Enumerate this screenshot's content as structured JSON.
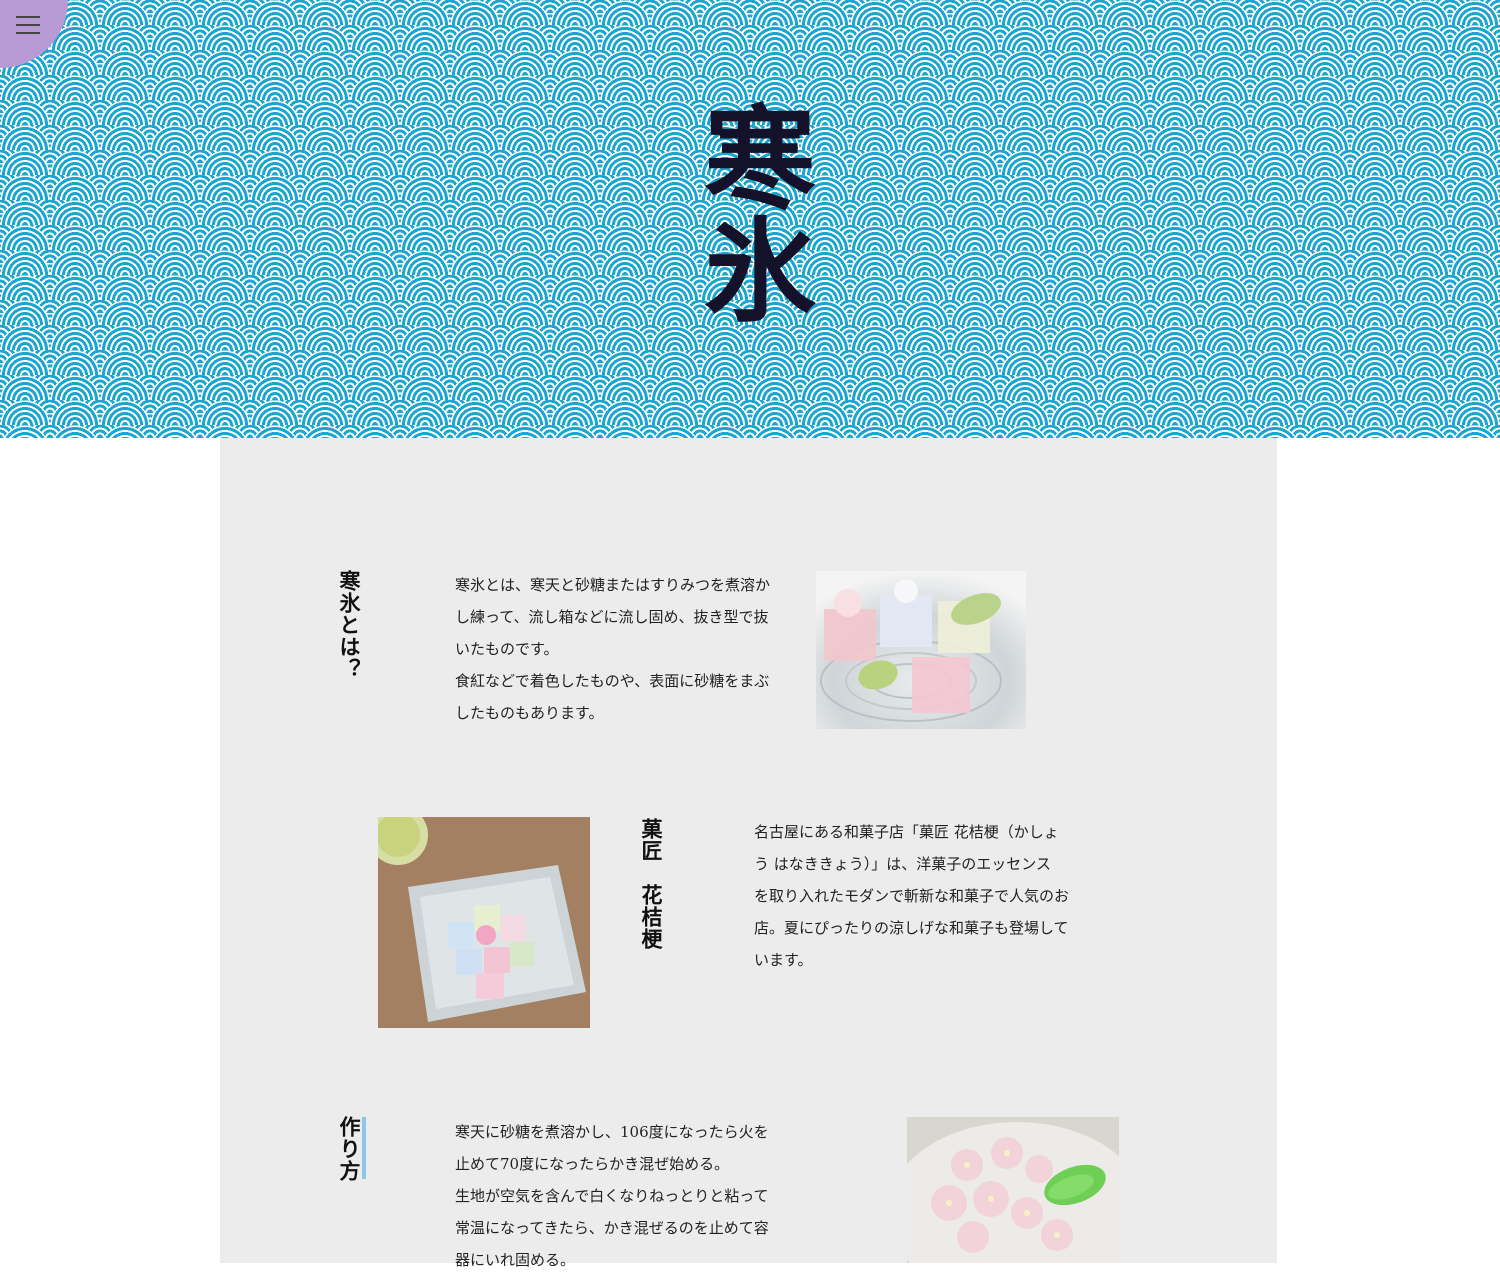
{
  "hero": {
    "title": "寒氷"
  },
  "menu": {
    "icon": "hamburger-menu-icon"
  },
  "sections": [
    {
      "heading": "寒氷とは？",
      "text": "寒氷とは、寒天と砂糖またはすりみつを煮溶か\nし練って、流し箱などに流し固め、抜き型で抜\nいたものです。\n食紅などで着色したものや、表面に砂糖をまぶ\nしたものもあります。"
    },
    {
      "heading": "菓匠　花桔梗",
      "text": "名古屋にある和菓子店「菓匠 花桔梗（かしょ\nう はなききょう）」は、洋菓子のエッセンス\nを取り入れたモダンで斬新な和菓子で人気のお\n店。夏にぴったりの涼しげな和菓子も登場して\nいます。"
    },
    {
      "heading": "作り方",
      "text": "寒天に砂糖を煮溶かし、106度になったら火を\n止めて70度になったらかき混ぜ始める。\n生地が空気を含んで白くなりねっとりと粘って\n常温になってきたら、かき混ぜるのを止めて容\n器にいれ固める。"
    }
  ],
  "colors": {
    "wave_blue": "#1ba6cf",
    "menu_purple": "#b89ad6",
    "panel_gray": "#ececec",
    "accent_blue": "#8cc7e6"
  }
}
